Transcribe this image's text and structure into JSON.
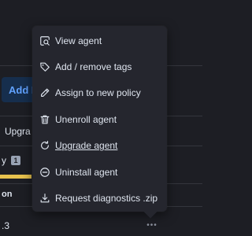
{
  "background": {
    "add_button_label": "Add F",
    "upgrade_tab_label": "Upgra",
    "row_label": "y",
    "row_badge": "1",
    "column_header": "on",
    "version_fragment": ".3",
    "row_actions_icon": "more-horizontal-icon"
  },
  "menu": {
    "items": [
      {
        "label": "View agent",
        "icon": "inspect-icon"
      },
      {
        "label": "Add / remove tags",
        "icon": "tag-icon"
      },
      {
        "label": "Assign to new policy",
        "icon": "pencil-icon"
      },
      {
        "label": "Unenroll agent",
        "icon": "trash-icon"
      },
      {
        "label": "Upgrade agent",
        "icon": "refresh-icon",
        "underlined": true
      },
      {
        "label": "Uninstall agent",
        "icon": "minus-circle-icon"
      },
      {
        "label": "Request diagnostics .zip",
        "icon": "download-icon"
      }
    ]
  },
  "colors": {
    "page_background": "#1d1e24",
    "menu_background": "#25262e",
    "text": "#dfe5ef",
    "accent": "#61a2ff",
    "warning": "#e7c24e"
  }
}
